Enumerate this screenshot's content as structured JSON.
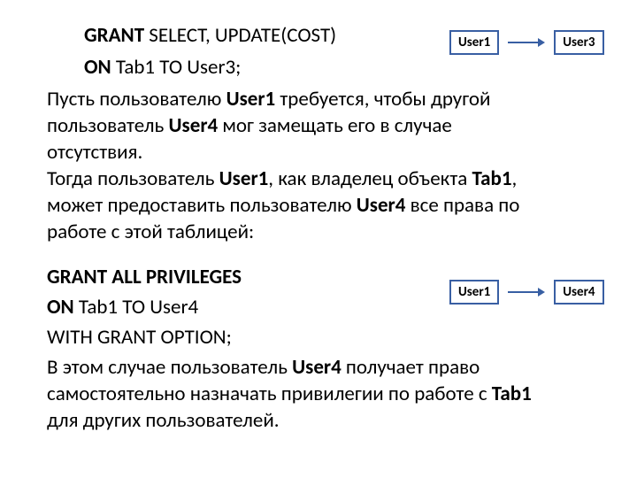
{
  "sql1": {
    "line1_bold": "GRANT",
    "line1_rest": "  SELECT,  UPDATE(COST)",
    "line2_bold": "ON",
    "line2_mid": " Tab1 ",
    "line2_to": "TO",
    "line2_user": "  User3;"
  },
  "para1": {
    "t1": "Пусть пользователю ",
    "b1": "User1",
    "t2": " требуется, чтобы другой пользователь ",
    "b2": "User4",
    "t3": " мог замещать его в случае отсутствия."
  },
  "para2": {
    "t1": "Тогда пользователь ",
    "b1": "User1",
    "t2": ", как владелец объекта ",
    "b2": "Tab1",
    "t3": ", может предоставить пользователю ",
    "b3": "User4",
    "t4": " все права по работе с этой таблицей:"
  },
  "sql2": {
    "line1": "GRANT ALL PRIVILEGES",
    "line2_bold": "ON",
    "line2_rest": " Tab1  TO  User4",
    "line3": "WITH  GRANT  OPTION;"
  },
  "para3": {
    "t1": "В этом случае пользователь ",
    "b1": "User4",
    "t2": "  получает право самостоятельно назначать привилегии по работе с ",
    "b2": "Tab1",
    "t3": " для других пользователей."
  },
  "diagrams": {
    "d1": {
      "from": "User1",
      "to": "User3"
    },
    "d2": {
      "from": "User1",
      "to": "User4"
    }
  }
}
